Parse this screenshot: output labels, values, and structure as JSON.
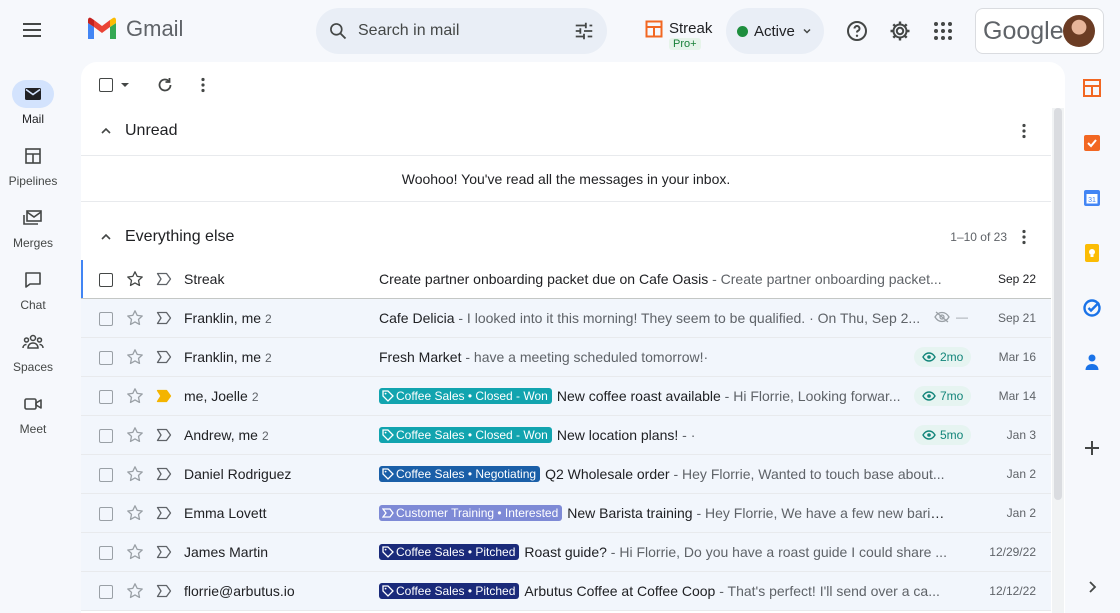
{
  "app": {
    "name": "Gmail",
    "search_placeholder": "Search in mail",
    "streak": {
      "name": "Streak",
      "plan": "Pro+"
    },
    "status": "Active",
    "google_label": "Google"
  },
  "rail": [
    {
      "label": "Mail",
      "icon": "mail-icon",
      "active": true
    },
    {
      "label": "Pipelines",
      "icon": "pipelines-icon",
      "active": false
    },
    {
      "label": "Merges",
      "icon": "merges-icon",
      "active": false
    },
    {
      "label": "Chat",
      "icon": "chat-icon",
      "active": false
    },
    {
      "label": "Spaces",
      "icon": "spaces-icon",
      "active": false
    },
    {
      "label": "Meet",
      "icon": "meet-icon",
      "active": false
    }
  ],
  "sections": {
    "unread": {
      "title": "Unread",
      "empty_message": "Woohoo! You've read all the messages in your inbox."
    },
    "everything_else": {
      "title": "Everything else",
      "range": "1–10 of 23"
    }
  },
  "emails": [
    {
      "sender": "Streak",
      "count": "",
      "labels": [],
      "subject": "Create partner onboarding packet due on Cafe Oasis",
      "snippet": " - Create partner onboarding packet...",
      "views": "",
      "date": "Sep 22",
      "starred": false,
      "important": false,
      "unread": true
    },
    {
      "sender": "Franklin, me",
      "count": "2",
      "labels": [],
      "subject": "Cafe Delicia",
      "snippet": " - I looked into it this morning! They seem to be qualified. · On Thu, Sep 2...",
      "views": "",
      "hidden_dash": "—",
      "date": "Sep 21",
      "starred": false,
      "important": false,
      "unread": false
    },
    {
      "sender": "Franklin, me",
      "count": "2",
      "labels": [],
      "subject": "Fresh Market",
      "snippet": " - have a meeting scheduled tomorrow!·",
      "views": "2mo",
      "date": "Mar 16",
      "starred": false,
      "important": false,
      "unread": false
    },
    {
      "sender": "me, Joelle",
      "count": "2",
      "labels": [
        {
          "text": "Coffee Sales • Closed - Won",
          "color": "#12a4af",
          "icon": "tag"
        }
      ],
      "subject": "New coffee roast available",
      "snippet": " - Hi Florrie, Looking forwar...",
      "views": "7mo",
      "date": "Mar 14",
      "starred": false,
      "important": true,
      "unread": false
    },
    {
      "sender": "Andrew, me",
      "count": "2",
      "labels": [
        {
          "text": "Coffee Sales • Closed - Won",
          "color": "#12a4af",
          "icon": "tag"
        }
      ],
      "subject": "New location plans!",
      "snippet": " - ·",
      "views": "5mo",
      "date": "Jan 3",
      "starred": false,
      "important": false,
      "unread": false
    },
    {
      "sender": "Daniel Rodriguez",
      "count": "",
      "labels": [
        {
          "text": "Coffee Sales • Negotiating",
          "color": "#1a5fa8",
          "icon": "tag"
        }
      ],
      "subject": "Q2 Wholesale order",
      "snippet": " - Hey Florrie, Wanted to touch base about...",
      "views": "",
      "date": "Jan 2",
      "starred": false,
      "important": false,
      "unread": false
    },
    {
      "sender": "Emma Lovett",
      "count": "",
      "labels": [
        {
          "text": "Customer Training • Interested",
          "color": "#7e8ad6",
          "icon": "flag"
        }
      ],
      "subject": "New Barista training",
      "snippet": " - Hey Florrie, We have a few new baris...",
      "views": "",
      "date": "Jan 2",
      "starred": false,
      "important": false,
      "unread": false
    },
    {
      "sender": "James Martin",
      "count": "",
      "labels": [
        {
          "text": "Coffee Sales • Pitched",
          "color": "#1a2a7a",
          "icon": "tag"
        }
      ],
      "subject": "Roast guide?",
      "snippet": " - Hi Florrie, Do you have a roast guide I could share ...",
      "views": "",
      "date": "12/29/22",
      "starred": false,
      "important": false,
      "unread": false
    },
    {
      "sender": "florrie@arbutus.io",
      "count": "",
      "labels": [
        {
          "text": "Coffee Sales • Pitched",
          "color": "#1a2a7a",
          "icon": "tag"
        }
      ],
      "subject": "Arbutus Coffee at Coffee Coop",
      "snippet": " - That's perfect! I'll send over a ca...",
      "views": "",
      "date": "12/12/22",
      "starred": false,
      "important": false,
      "unread": false
    }
  ],
  "right_rail": [
    "streak-box-icon",
    "tasks-check-icon",
    "calendar-icon",
    "keep-icon",
    "tasks-icon",
    "contacts-icon",
    "add-icon",
    "expand-icon"
  ],
  "colors": {
    "accent": "#0b57d0",
    "selected_bg": "#d3e3fd",
    "read_row_bg": "#f2f6fc",
    "views_text": "#12857a",
    "important": "#f4b400"
  }
}
